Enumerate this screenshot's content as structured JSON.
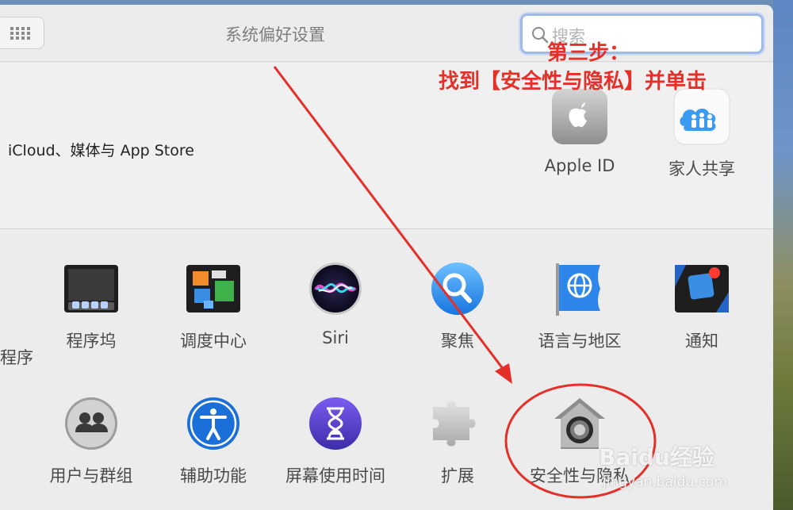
{
  "window": {
    "title": "系统偏好设置"
  },
  "search": {
    "placeholder": "搜索"
  },
  "account": {
    "label": "iCloud、媒体与 App Store",
    "items": [
      {
        "label": "Apple ID",
        "icon": "apple-id-icon"
      },
      {
        "label": "家人共享",
        "icon": "family-sharing-icon"
      }
    ]
  },
  "panes": {
    "row1_cut_label": "程序",
    "row1": [
      {
        "label": "程序坞",
        "icon": "dock-icon"
      },
      {
        "label": "调度中心",
        "icon": "mission-control-icon"
      },
      {
        "label": "Siri",
        "icon": "siri-icon"
      },
      {
        "label": "聚焦",
        "icon": "spotlight-icon"
      },
      {
        "label": "语言与地区",
        "icon": "language-region-icon"
      },
      {
        "label": "通知",
        "icon": "notifications-icon"
      }
    ],
    "row2": [
      {
        "label": "用户与群组",
        "icon": "users-groups-icon"
      },
      {
        "label": "辅助功能",
        "icon": "accessibility-icon"
      },
      {
        "label": "屏幕使用时间",
        "icon": "screen-time-icon"
      },
      {
        "label": "扩展",
        "icon": "extensions-icon"
      },
      {
        "label": "安全性与隐私",
        "icon": "security-privacy-icon"
      }
    ]
  },
  "annotation": {
    "line1": "第三步：",
    "line2": "找到【安全性与隐私】并单击",
    "color": "#e5302a"
  },
  "watermark": {
    "brand": "Baidu经验",
    "url": "jingyan.baidu.com"
  }
}
